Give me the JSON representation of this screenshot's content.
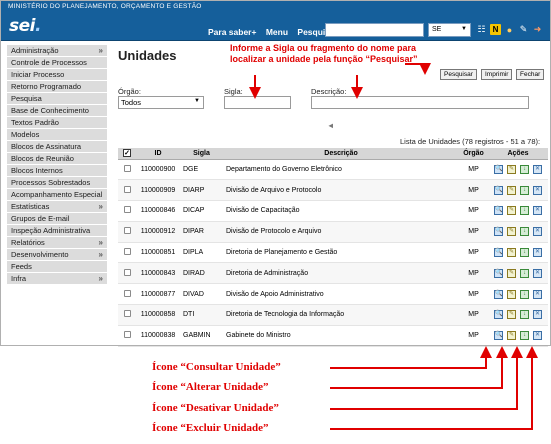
{
  "header": {
    "ministry": "MINISTÉRIO DO PLANEJAMENTO, ORÇAMENTO E GESTÃO",
    "logo": "sei",
    "logo_dot": ".",
    "links": [
      "Para saber+",
      "Menu",
      "Pesquisa"
    ],
    "search_value": "",
    "org_selected": "SE",
    "icons": [
      "list-icon",
      "n-icon",
      "user-icon",
      "wrench-icon",
      "exit-icon"
    ]
  },
  "sidebar": {
    "items": [
      {
        "label": "Administração",
        "chevron": "»"
      },
      {
        "label": "Controle de Processos",
        "chevron": ""
      },
      {
        "label": "Iniciar Processo",
        "chevron": ""
      },
      {
        "label": "Retorno Programado",
        "chevron": ""
      },
      {
        "label": "Pesquisa",
        "chevron": ""
      },
      {
        "label": "Base de Conhecimento",
        "chevron": ""
      },
      {
        "label": "Textos Padrão",
        "chevron": ""
      },
      {
        "label": "Modelos",
        "chevron": ""
      },
      {
        "label": "Blocos de Assinatura",
        "chevron": ""
      },
      {
        "label": "Blocos de Reunião",
        "chevron": ""
      },
      {
        "label": "Blocos Internos",
        "chevron": ""
      },
      {
        "label": "Processos Sobrestados",
        "chevron": ""
      },
      {
        "label": "Acompanhamento Especial",
        "chevron": ""
      },
      {
        "label": "Estatísticas",
        "chevron": "»"
      },
      {
        "label": "Grupos de E-mail",
        "chevron": ""
      },
      {
        "label": "Inspeção Administrativa",
        "chevron": ""
      },
      {
        "label": "Relatórios",
        "chevron": "»"
      },
      {
        "label": "Desenvolvimento",
        "chevron": "»"
      },
      {
        "label": "Feeds",
        "chevron": ""
      },
      {
        "label": "Infra",
        "chevron": "»"
      }
    ]
  },
  "page": {
    "title": "Unidades",
    "buttons": {
      "search": "Pesquisar",
      "print": "Imprimir",
      "close": "Fechar"
    },
    "filters": {
      "orgao_label": "Órgão:",
      "orgao_value": "Todos",
      "sigla_label": "Sigla:",
      "sigla_value": "",
      "descricao_label": "Descrição:",
      "descricao_value": ""
    },
    "paging_arrow": "◄",
    "caption": "Lista de Unidades (78 registros - 51 a 78):"
  },
  "table": {
    "headers": {
      "check": "✓",
      "id": "ID",
      "sigla": "Sigla",
      "descricao": "Descrição",
      "orgao": "Órgão",
      "acoes": "Ações"
    },
    "rows": [
      {
        "id": "110000900",
        "sigla": "DGE",
        "descricao": "Departamento do Governo Eletrônico",
        "orgao": "MP"
      },
      {
        "id": "110000909",
        "sigla": "DIARP",
        "descricao": "Divisão de Arquivo e Protocolo",
        "orgao": "MP"
      },
      {
        "id": "110000846",
        "sigla": "DICAP",
        "descricao": "Divisão de Capacitação",
        "orgao": "MP"
      },
      {
        "id": "110000912",
        "sigla": "DIPAR",
        "descricao": "Divisão de Protocolo e Arquivo",
        "orgao": "MP"
      },
      {
        "id": "110000851",
        "sigla": "DIPLA",
        "descricao": "Diretoria de Planejamento e Gestão",
        "orgao": "MP"
      },
      {
        "id": "110000843",
        "sigla": "DIRAD",
        "descricao": "Diretoria de Administração",
        "orgao": "MP"
      },
      {
        "id": "110000877",
        "sigla": "DIVAD",
        "descricao": "Divisão de Apoio Administrativo",
        "orgao": "MP"
      },
      {
        "id": "110000858",
        "sigla": "DTI",
        "descricao": "Diretoria de Tecnologia da Informação",
        "orgao": "MP"
      },
      {
        "id": "110000838",
        "sigla": "GABMIN",
        "descricao": "Gabinete do Ministro",
        "orgao": "MP"
      }
    ]
  },
  "annotations": {
    "top_line1": "Informe a Sigla ou fragmento do nome para",
    "top_line2": "localizar a unidade pela função “Pesquisar”",
    "legend": [
      "Ícone “Consultar Unidade”",
      "Ícone “Alterar Unidade”",
      "Ícone “Desativar Unidade”",
      "Ícone “Excluir Unidade”"
    ]
  },
  "colors": {
    "header_blue": "#155f9b",
    "annotation_red": "#e00000"
  }
}
